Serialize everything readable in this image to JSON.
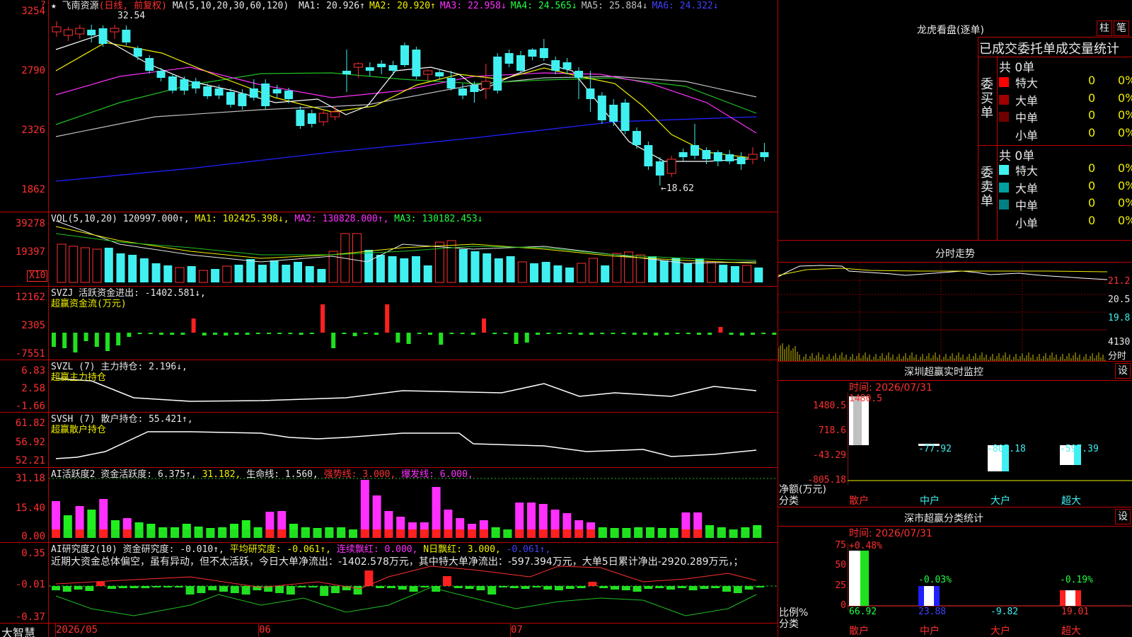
{
  "stock": {
    "name": "飞南资源",
    "adjust": "(日线, 前复权)",
    "ma_label": "MA(5,10,20,30,60,120)",
    "ma_values": [
      {
        "label": "MA1: 20.926↑",
        "color": "#e8e8e8"
      },
      {
        "label": "MA2: 20.920↑",
        "color": "#f0f000"
      },
      {
        "label": "MA3: 22.958↓",
        "color": "#ff30ff"
      },
      {
        "label": "MA4: 24.565↓",
        "color": "#20ff40"
      },
      {
        "label": "MA5: 25.884↓",
        "color": "#c0c0c0"
      },
      {
        "label": "MA6: 24.322↓",
        "color": "#4040ff"
      }
    ],
    "high_marker": "32.54",
    "low_marker": "←18.62",
    "y_axis": [
      "3254",
      "2790",
      "2326",
      "1862"
    ]
  },
  "vol_panel": {
    "title": "VOL(5,10,20)",
    "value": "120997.000↑,",
    "ma1": "MA1: 102425.398↓,",
    "ma2": "MA2: 130828.000↑,",
    "ma3": "MA3: 130182.453↓",
    "y_axis": [
      "39278",
      "19397"
    ],
    "unit": "X10"
  },
  "svzj_panel": {
    "title": "SVZJ 活跃资金进出: -1402.581↓,",
    "subtitle": "超赢资金流(万元)",
    "y_axis": [
      "12162",
      "2305",
      "-7551"
    ]
  },
  "svzl_panel": {
    "title": "SVZL (7) 主力持仓: 2.196↓,",
    "subtitle": "超赢主力持仓",
    "y_axis": [
      "6.83",
      "2.58",
      "-1.66"
    ]
  },
  "svsh_panel": {
    "title": "SVSH (7) 散户持仓: 55.421↑,",
    "subtitle": "超赢散户持仓",
    "y_axis": [
      "61.82",
      "56.92",
      "52.21"
    ]
  },
  "ai_active_panel": {
    "title": "AI活跃度2 资金活跃度: 6.375↑,",
    "v2": "31.182,",
    "life": "生命线: 1.560,",
    "strong": "强势线: 3.000,",
    "burst": "爆发线: 6.000,",
    "y_axis": [
      "31.18",
      "15.40",
      "0.00"
    ]
  },
  "ai_research_panel": {
    "title": "AI研究度2(10) 资金研究度: -0.010↑,",
    "avg": "平均研究度: -0.061↑,",
    "cont": "连续飘红: 0.000,",
    "nday": "N日飘红: 3.000,",
    "last": "-0.061↑,",
    "commentary": "近期大资金总体偏空，虽有异动，但不太活跃，今日大单净流出：-1402.578万元，其中特大单净流出：-597.394万元，大单5日累计净出-2920.289万元，；",
    "y_axis": [
      "0.35",
      "-0.01",
      "-0.37"
    ]
  },
  "date_axis": {
    "brand": "大智慧",
    "labels": [
      "2026/05",
      "06",
      "07"
    ]
  },
  "right_panel": {
    "longhu_title": "龙虎看盘(逐单)",
    "btn_zhu": "柱",
    "btn_bi": "笔",
    "tabs_line": "已成交委托单成交量统计",
    "buy_side": {
      "label": "委买单",
      "total": "共 0单",
      "rows": [
        {
          "cat": "特大",
          "count": "0",
          "pct": "0%",
          "color": "#ff0000"
        },
        {
          "cat": "大单",
          "count": "0",
          "pct": "0%",
          "color": "#a00000"
        },
        {
          "cat": "中单",
          "count": "0",
          "pct": "0%",
          "color": "#700000"
        },
        {
          "cat": "小单",
          "count": "0",
          "pct": "0%",
          "color": "#000000"
        }
      ]
    },
    "sell_side": {
      "label": "委卖单",
      "total": "共 0单",
      "rows": [
        {
          "cat": "特大",
          "count": "0",
          "pct": "0%",
          "color": "#40f0f0"
        },
        {
          "cat": "大单",
          "count": "0",
          "pct": "0%",
          "color": "#00a0a0"
        },
        {
          "cat": "中单",
          "count": "0",
          "pct": "0%",
          "color": "#008080"
        },
        {
          "cat": "小单",
          "count": "0",
          "pct": "0%",
          "color": "#000000"
        }
      ]
    },
    "intraday": {
      "title": "分时走势",
      "y_labels": [
        "21.2",
        "20.5",
        "19.8",
        "4130"
      ],
      "unit": "分时"
    },
    "monitor": {
      "title": "深圳超赢实时监控",
      "btn": "设",
      "time": "时间: 2026/07/31",
      "y_axis": [
        "1480.5",
        "718.6",
        "-43.29",
        "-805.18"
      ],
      "bars": [
        {
          "label": "散户",
          "value": "1480.5"
        },
        {
          "label": "中户",
          "value": "-77.92"
        },
        {
          "label": "大户",
          "value": "-805.18"
        },
        {
          "label": "超大",
          "value": "-597.39"
        }
      ],
      "axis_caption_1": "净额(万元)",
      "axis_caption_2": "分类"
    },
    "stats": {
      "title": "深市超赢分类统计",
      "btn": "设",
      "time": "时间: 2026/07/31",
      "y_axis": [
        "75",
        "50",
        "25",
        "0"
      ],
      "bars": [
        {
          "label": "散户",
          "top": "+0.48%",
          "bottom": "66.92"
        },
        {
          "label": "中户",
          "top": "-0.03%",
          "bottom": "23.88"
        },
        {
          "label": "大户",
          "top": "",
          "bottom": "-9.82"
        },
        {
          "label": "超大",
          "top": "-0.19%",
          "bottom": "19.01"
        }
      ],
      "axis_caption_1": "比例%",
      "axis_caption_2": "分类"
    }
  }
}
